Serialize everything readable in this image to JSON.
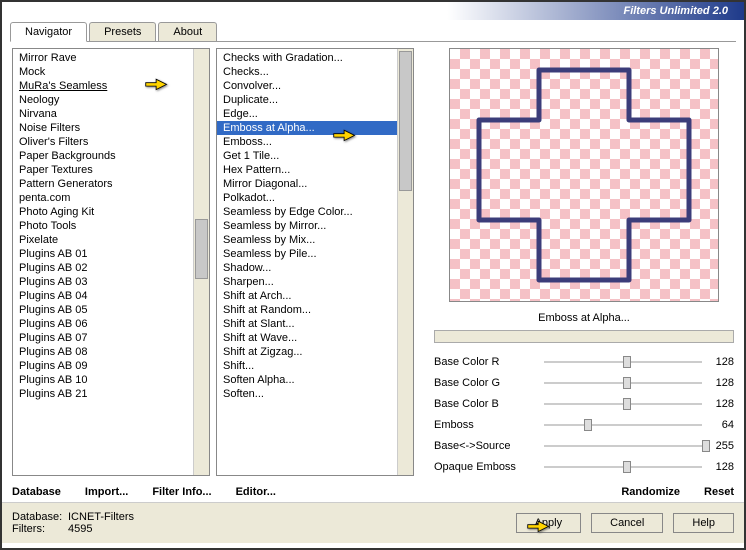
{
  "title": "Filters Unlimited 2.0",
  "tabs": {
    "navigator": "Navigator",
    "presets": "Presets",
    "about": "About"
  },
  "categories": [
    "Mirror Rave",
    "Mock",
    "MuRa's Seamless",
    "Neology",
    "Nirvana",
    "Noise Filters",
    "Oliver's Filters",
    "Paper Backgrounds",
    "Paper Textures",
    "Pattern Generators",
    "penta.com",
    "Photo Aging Kit",
    "Photo Tools",
    "Pixelate",
    "Plugins AB 01",
    "Plugins AB 02",
    "Plugins AB 03",
    "Plugins AB 04",
    "Plugins AB 05",
    "Plugins AB 06",
    "Plugins AB 07",
    "Plugins AB 08",
    "Plugins AB 09",
    "Plugins AB 10",
    "Plugins AB 21"
  ],
  "filters": [
    "Checks with Gradation...",
    "Checks...",
    "Convolver...",
    "Duplicate...",
    "Edge...",
    "Emboss at Alpha...",
    "Emboss...",
    "Get 1 Tile...",
    "Hex Pattern...",
    "Mirror Diagonal...",
    "Polkadot...",
    "Seamless by Edge Color...",
    "Seamless by Mirror...",
    "Seamless by Mix...",
    "Seamless by Pile...",
    "Shadow...",
    "Sharpen...",
    "Shift at Arch...",
    "Shift at Random...",
    "Shift at Slant...",
    "Shift at Wave...",
    "Shift at Zigzag...",
    "Shift...",
    "Soften Alpha...",
    "Soften..."
  ],
  "highlighted_category": "MuRa's Seamless",
  "selected_filter": "Emboss at Alpha...",
  "selected_filter_index": 5,
  "preview_label": "Emboss at Alpha...",
  "params": [
    {
      "label": "Base Color R",
      "value": 128,
      "pct": 50
    },
    {
      "label": "Base Color G",
      "value": 128,
      "pct": 50
    },
    {
      "label": "Base Color B",
      "value": 128,
      "pct": 50
    },
    {
      "label": "Emboss",
      "value": 64,
      "pct": 25
    },
    {
      "label": "Base<->Source",
      "value": 255,
      "pct": 100
    },
    {
      "label": "Opaque Emboss",
      "value": 128,
      "pct": 50
    }
  ],
  "toolbar": {
    "database": "Database",
    "import": "Import...",
    "filter_info": "Filter Info...",
    "editor": "Editor...",
    "randomize": "Randomize",
    "reset": "Reset"
  },
  "info": {
    "database_key": "Database:",
    "database_val": "ICNET-Filters",
    "filters_key": "Filters:",
    "filters_val": "4595"
  },
  "buttons": {
    "apply": "Apply",
    "cancel": "Cancel",
    "help": "Help"
  }
}
